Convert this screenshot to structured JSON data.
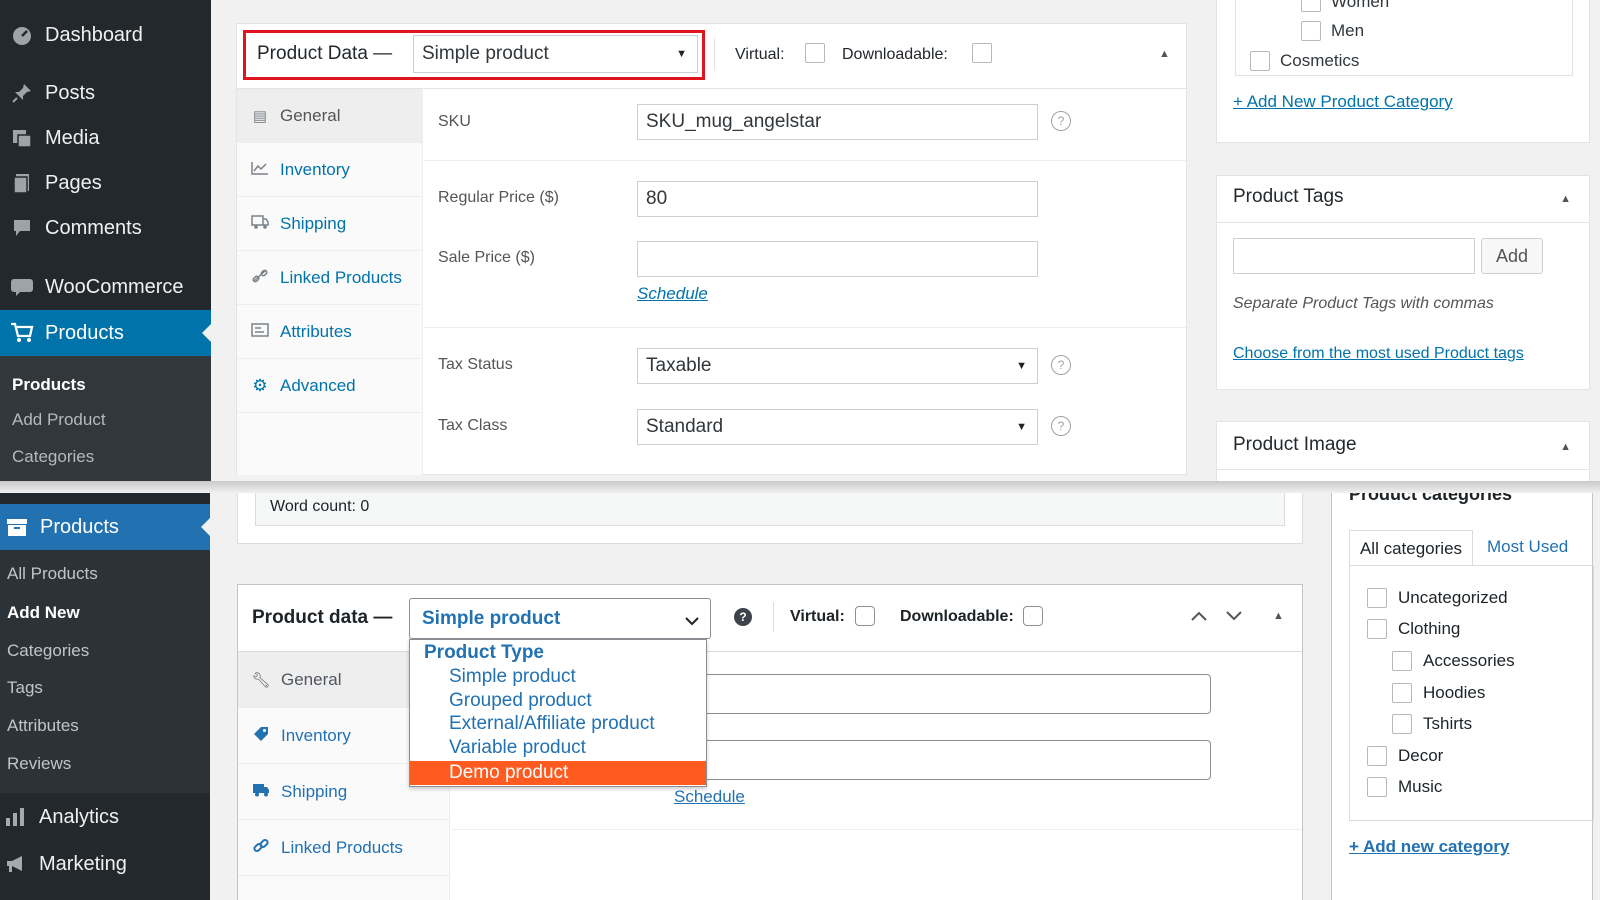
{
  "top": {
    "sidebar": {
      "items": [
        {
          "label": "Dashboard",
          "icon": "dashboard-icon"
        },
        {
          "label": "Posts",
          "icon": "pin-icon"
        },
        {
          "label": "Media",
          "icon": "media-icon"
        },
        {
          "label": "Pages",
          "icon": "pages-icon"
        },
        {
          "label": "Comments",
          "icon": "comments-icon"
        },
        {
          "label": "WooCommerce",
          "icon": "woocommerce-icon"
        },
        {
          "label": "Products",
          "icon": "products-icon"
        }
      ],
      "submenu": [
        "Products",
        "Add Product",
        "Categories"
      ]
    },
    "product_data": {
      "title": "Product Data —",
      "type_value": "Simple product",
      "virtual_label": "Virtual:",
      "downloadable_label": "Downloadable:",
      "tabs": [
        {
          "label": "General",
          "icon": "general-icon"
        },
        {
          "label": "Inventory",
          "icon": "inventory-icon"
        },
        {
          "label": "Shipping",
          "icon": "shipping-icon"
        },
        {
          "label": "Linked Products",
          "icon": "link-icon"
        },
        {
          "label": "Attributes",
          "icon": "attributes-icon"
        },
        {
          "label": "Advanced",
          "icon": "gear-icon"
        }
      ],
      "fields": {
        "sku_label": "SKU",
        "sku_value": "SKU_mug_angelstar",
        "regular_price_label": "Regular Price ($)",
        "regular_price_value": "80",
        "sale_price_label": "Sale Price ($)",
        "sale_price_value": "",
        "schedule_link": "Schedule",
        "tax_status_label": "Tax Status",
        "tax_status_value": "Taxable",
        "tax_class_label": "Tax Class",
        "tax_class_value": "Standard"
      }
    },
    "categories": {
      "items": [
        "Women",
        "Men",
        "Cosmetics"
      ],
      "add_link": "+ Add New Product Category"
    },
    "tags": {
      "title": "Product Tags",
      "add_button": "Add",
      "hint": "Separate Product Tags with commas",
      "choose_link": "Choose from the most used Product tags"
    },
    "image": {
      "title": "Product Image"
    },
    "accent_color": "#0073aa",
    "highlight_color": "#e0141e"
  },
  "bottom": {
    "sidebar": {
      "products_label": "Products",
      "submenu": [
        "All Products",
        "Add New",
        "Categories",
        "Tags",
        "Attributes",
        "Reviews"
      ],
      "analytics_label": "Analytics",
      "marketing_label": "Marketing"
    },
    "word_count": "Word count: 0",
    "product_data": {
      "title": "Product data —",
      "type_value": "Simple product",
      "virtual_label": "Virtual:",
      "downloadable_label": "Downloadable:",
      "tabs": [
        "General",
        "Inventory",
        "Shipping",
        "Linked Products"
      ],
      "schedule_link": "Schedule",
      "dropdown": {
        "group_label": "Product Type",
        "options": [
          "Simple product",
          "Grouped product",
          "External/Affiliate product",
          "Variable product",
          "Demo product"
        ],
        "highlighted": "Demo product",
        "highlight_color": "#ff5a1f"
      }
    },
    "categories": {
      "title": "Product categories",
      "tab_all": "All categories",
      "tab_most_used": "Most Used",
      "items": [
        "Uncategorized",
        "Clothing",
        "Accessories",
        "Hoodies",
        "Tshirts",
        "Decor",
        "Music"
      ],
      "add_link": "+ Add new category"
    }
  }
}
